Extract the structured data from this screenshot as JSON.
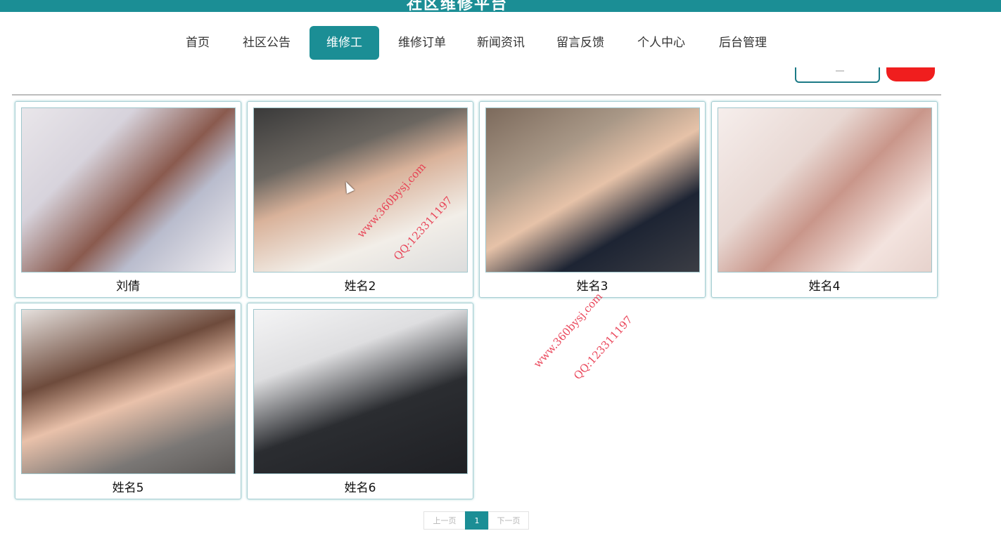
{
  "site": {
    "title": "社区维修平台"
  },
  "nav": {
    "items": [
      {
        "label": "首页",
        "active": false
      },
      {
        "label": "社区公告",
        "active": false
      },
      {
        "label": "维修工",
        "active": true
      },
      {
        "label": "维修订单",
        "active": false
      },
      {
        "label": "新闻资讯",
        "active": false
      },
      {
        "label": "留言反馈",
        "active": false
      },
      {
        "label": "个人中心",
        "active": false
      },
      {
        "label": "后台管理",
        "active": false
      }
    ]
  },
  "workers": [
    {
      "name": "刘倩",
      "photo": "portrait-photo"
    },
    {
      "name": "姓名2",
      "photo": "portrait-photo"
    },
    {
      "name": "姓名3",
      "photo": "portrait-photo"
    },
    {
      "name": "姓名4",
      "photo": "portrait-photo"
    },
    {
      "name": "姓名5",
      "photo": "portrait-photo"
    },
    {
      "name": "姓名6",
      "photo": "portrait-photo"
    }
  ],
  "pagination": {
    "prev": "上一页",
    "current": "1",
    "next": "下一页"
  },
  "watermarks": [
    {
      "site": "www.360bysj.com",
      "qq": "QQ:123311197"
    },
    {
      "site": "www.360bysj.com",
      "qq": "QQ:123311197"
    }
  ],
  "colors": {
    "primary": "#1b8e95",
    "danger": "#f01e1e"
  }
}
